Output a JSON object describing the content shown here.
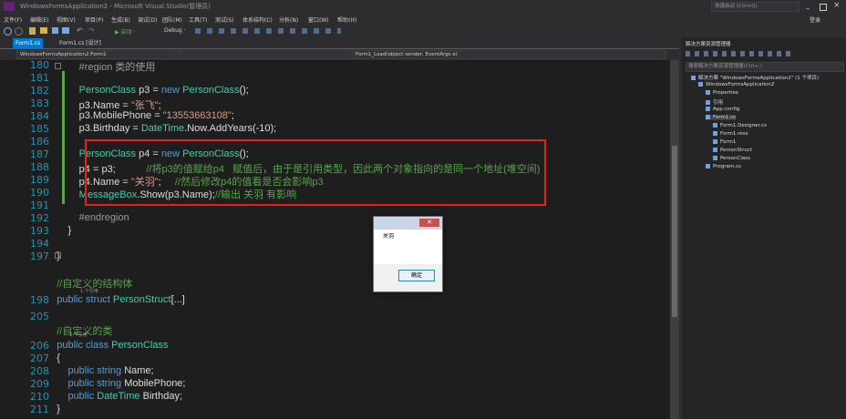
{
  "window": {
    "title": "WindowsFormsApplication2 - Microsoft Visual Studio(管理员)",
    "quick_launch": "快速启动 (Ctrl+Q)",
    "login": "登录"
  },
  "menu": [
    "文件(F)",
    "编辑(E)",
    "视图(V)",
    "项目(P)",
    "生成(B)",
    "调试(D)",
    "团队(M)",
    "工具(T)",
    "测试(S)",
    "体系结构(C)",
    "分析(N)",
    "窗口(W)",
    "帮助(H)"
  ],
  "toolbar": {
    "start": "▶ 启动 ·",
    "config": "Debug ·"
  },
  "tabs": [
    {
      "label": "Form1.cs",
      "active": true
    },
    {
      "label": "Form1.cs [设计]",
      "active": false
    }
  ],
  "nav": {
    "project": "WindowsFormsApplication2.Form1",
    "member": "Form1_Load(object sender, EventArgs e)"
  },
  "editor": {
    "lines": [
      {
        "n": "180",
        "code": [
          [
            "gr",
            "            #region 类的使用"
          ]
        ]
      },
      {
        "n": "181",
        "code": []
      },
      {
        "n": "182",
        "code": [
          [
            "ty",
            "            PersonClass"
          ],
          [
            "",
            " p3 = "
          ],
          [
            "kw",
            "new"
          ],
          [
            "",
            " "
          ],
          [
            "ty",
            "PersonClass"
          ],
          [
            "",
            "();"
          ]
        ]
      },
      {
        "n": "183",
        "code": [
          [
            "",
            "            p3.Name = "
          ],
          [
            "st",
            "\"张飞\""
          ],
          [
            "",
            ";"
          ]
        ]
      },
      {
        "n": "184",
        "code": [
          [
            "",
            "            p3.MobilePhone = "
          ],
          [
            "st",
            "\"13553663108\""
          ],
          [
            "",
            ";"
          ]
        ]
      },
      {
        "n": "185",
        "code": [
          [
            "",
            "            p3.Birthday = "
          ],
          [
            "ty",
            "DateTime"
          ],
          [
            "",
            ".Now.AddYears(-10);"
          ]
        ]
      },
      {
        "n": "186",
        "code": []
      },
      {
        "n": "187",
        "code": [
          [
            "ty",
            "            PersonClass"
          ],
          [
            "",
            " p4 = "
          ],
          [
            "kw",
            "new"
          ],
          [
            "",
            " "
          ],
          [
            "ty",
            "PersonClass"
          ],
          [
            "",
            "();"
          ]
        ]
      },
      {
        "n": "188",
        "code": [
          [
            "",
            "            p4 = p3;           "
          ],
          [
            "cm",
            "//将p3的值赋给p4   赋值后，由于是引用类型，因此两个对象指向的是同一个地址(堆空间)"
          ]
        ]
      },
      {
        "n": "189",
        "code": [
          [
            "",
            "            p4.Name = "
          ],
          [
            "st",
            "\"关羽\""
          ],
          [
            "",
            ";     "
          ],
          [
            "cm",
            "//然后修改p4的值看是否会影响p3"
          ]
        ]
      },
      {
        "n": "190",
        "code": [
          [
            "ty",
            "            MessageBox"
          ],
          [
            "",
            ".Show(p3.Name);"
          ],
          [
            "cm",
            "//输出 关羽 有影响"
          ]
        ]
      },
      {
        "n": "191",
        "code": []
      },
      {
        "n": "192",
        "code": [
          [
            "gr",
            "            #endregion"
          ]
        ]
      },
      {
        "n": "193",
        "code": [
          [
            "",
            "        }"
          ]
        ]
      },
      {
        "n": "194",
        "code": []
      },
      {
        "n": "197",
        "code": [
          [
            "",
            "    }"
          ]
        ]
      },
      {
        "n": "",
        "code": []
      },
      {
        "n": "",
        "code": [
          [
            "cm",
            "    //自定义的结构体"
          ]
        ]
      },
      {
        "n": "198",
        "code": [
          [
            "kw",
            "    public struct"
          ],
          [
            "",
            " "
          ],
          [
            "ty",
            "PersonStruct"
          ],
          [
            "",
            "[...]"
          ]
        ]
      },
      {
        "n": "205",
        "code": []
      },
      {
        "n": "",
        "code": [
          [
            "cm",
            "    //自定义的类"
          ]
        ]
      },
      {
        "n": "206",
        "code": [
          [
            "kw",
            "    public class"
          ],
          [
            "",
            " "
          ],
          [
            "ty",
            "PersonClass"
          ]
        ]
      },
      {
        "n": "207",
        "code": [
          [
            "",
            "    {"
          ]
        ]
      },
      {
        "n": "208",
        "code": [
          [
            "kw",
            "        public string"
          ],
          [
            "",
            " Name;"
          ]
        ]
      },
      {
        "n": "209",
        "code": [
          [
            "kw",
            "        public string"
          ],
          [
            "",
            " MobilePhone;"
          ]
        ]
      },
      {
        "n": "210",
        "code": [
          [
            "kw",
            "        public"
          ],
          [
            "",
            " "
          ],
          [
            "ty",
            "DateTime"
          ],
          [
            "",
            " Birthday;"
          ]
        ]
      },
      {
        "n": "211",
        "code": [
          [
            "",
            "    }"
          ]
        ]
      }
    ],
    "refs_1": "1 个引用",
    "refs_3": "3 个引用"
  },
  "solution_explorer": {
    "title": "解决方案资源管理器",
    "search": "搜索解决方案资源管理器(Ctrl+;)",
    "items": [
      {
        "label": "解决方案 \"WindowsFormsApplication2\" (1 个项目)",
        "level": 0,
        "icon": "solution-icon"
      },
      {
        "label": "WindowsFormsApplication2",
        "level": 1,
        "icon": "csharp-project-icon"
      },
      {
        "label": "Properties",
        "level": 2,
        "icon": "wrench-icon"
      },
      {
        "label": "引用",
        "level": 2,
        "icon": "references-icon"
      },
      {
        "label": "App.config",
        "level": 2,
        "icon": "config-icon"
      },
      {
        "label": "Form1.cs",
        "level": 2,
        "icon": "form-icon"
      },
      {
        "label": "Form1.Designer.cs",
        "level": 3,
        "icon": "csharp-file-icon"
      },
      {
        "label": "Form1.resx",
        "level": 3,
        "icon": "resx-icon"
      },
      {
        "label": "Form1",
        "level": 3,
        "icon": "class-icon"
      },
      {
        "label": "PersonStruct",
        "level": 3,
        "icon": "struct-icon"
      },
      {
        "label": "PersonClass",
        "level": 3,
        "icon": "class-icon"
      },
      {
        "label": "Program.cs",
        "level": 2,
        "icon": "csharp-file-icon"
      }
    ]
  },
  "dialog": {
    "message": "关羽",
    "ok_label": "确定",
    "close_glyph": "✕"
  }
}
